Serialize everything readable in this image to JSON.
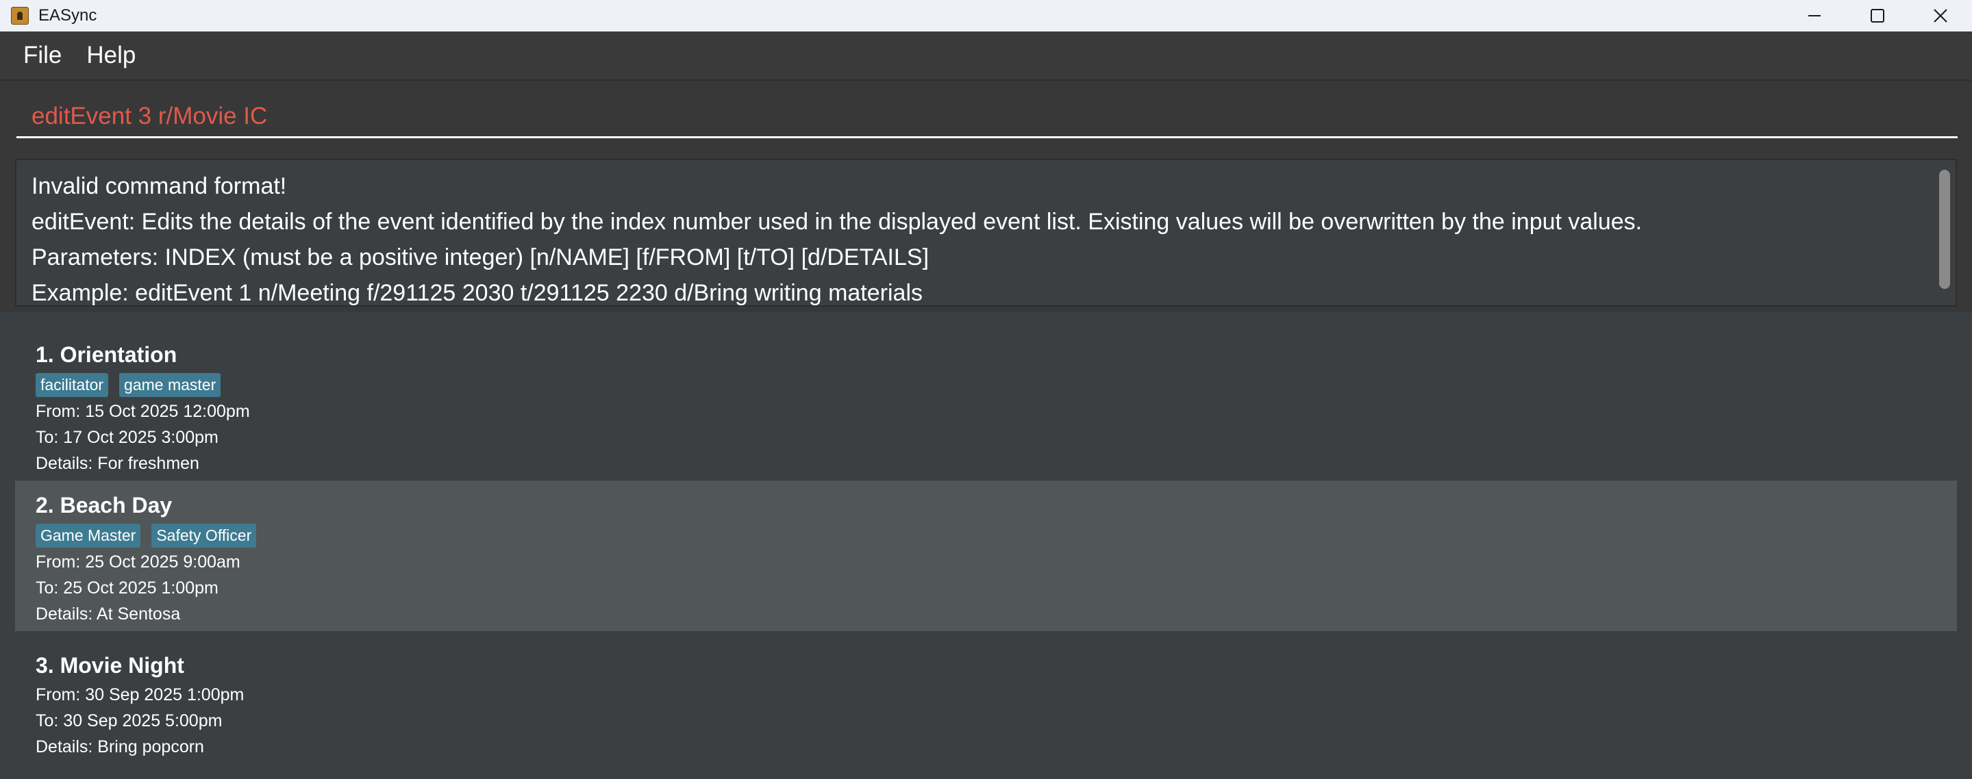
{
  "window": {
    "title": "EASync",
    "app_icon": "easync-app-icon",
    "controls": [
      "minimize-icon",
      "maximize-icon",
      "close-icon"
    ]
  },
  "menu": {
    "items": [
      "File",
      "Help"
    ]
  },
  "command": {
    "value": "editEvent 3 r/Movie IC",
    "color": "#e2594b"
  },
  "result": {
    "lines": [
      "Invalid command format!",
      "editEvent: Edits the details of the event identified by the index number used in the displayed event list. Existing values will be overwritten by the input values.",
      "Parameters: INDEX (must be a positive integer) [n/NAME] [f/FROM] [t/TO] [d/DETAILS]",
      "Example: editEvent 1 n/Meeting f/291125 2030 t/291125 2230 d/Bring writing materials"
    ]
  },
  "events": [
    {
      "name": "1. Orientation",
      "tags": [
        "facilitator",
        "game master"
      ],
      "from": "From: 15 Oct 2025 12:00pm",
      "to": "To: 17 Oct 2025 3:00pm",
      "details": "Details: For freshmen",
      "selected": false
    },
    {
      "name": "2. Beach Day",
      "tags": [
        "Game Master",
        "Safety Officer"
      ],
      "from": "From: 25 Oct 2025 9:00am",
      "to": "To: 25 Oct 2025 1:00pm",
      "details": "Details: At Sentosa",
      "selected": true
    },
    {
      "name": "3. Movie Night",
      "tags": [],
      "from": "From: 30 Sep 2025 1:00pm",
      "to": "To: 30 Sep 2025 5:00pm",
      "details": "Details: Bring popcorn",
      "selected": false
    }
  ],
  "colors": {
    "background": "#3c3f41",
    "selected_card": "#515658",
    "tag": "#3e7b91",
    "error_text": "#e2594b"
  }
}
